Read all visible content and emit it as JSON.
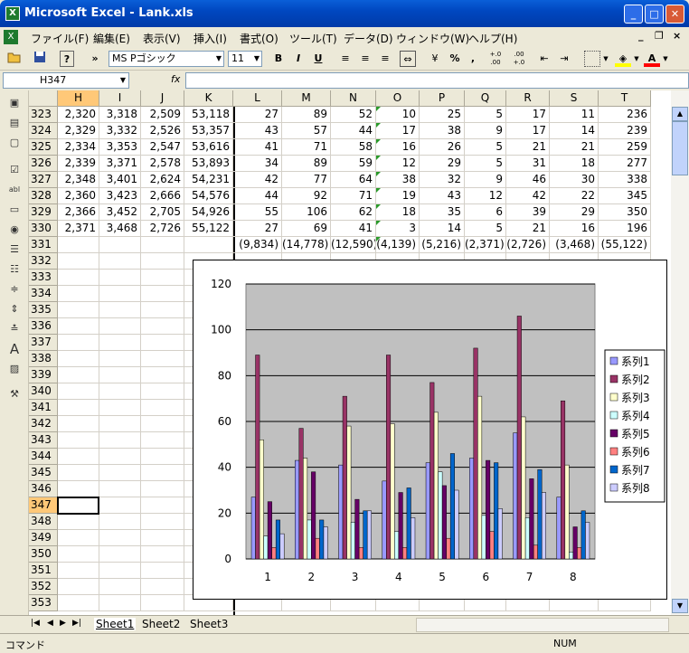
{
  "window": {
    "title": "Microsoft Excel - Lank.xls",
    "app_icon": "X",
    "min": "_",
    "max": "□",
    "close": "✕"
  },
  "menu": {
    "items": [
      "ファイル(F)",
      "編集(E)",
      "表示(V)",
      "挿入(I)",
      "書式(O)",
      "ツール(T)",
      "データ(D)",
      "ウィンドウ(W)",
      "ヘルプ(H)"
    ],
    "doc_min": "_",
    "doc_restore": "❐",
    "doc_close": "×"
  },
  "toolbar": {
    "font": "MS Pゴシック",
    "size": "11",
    "bold": "B",
    "italic": "I",
    "underline": "U",
    "percent": "%",
    "comma": ",",
    "inc_dec": "+.0 .00",
    "dec_dec": ".00 +.0",
    "more": "»"
  },
  "formula": {
    "name_box": "H347",
    "fx": "fx",
    "value": ""
  },
  "columns": [
    "H",
    "I",
    "J",
    "K",
    "L",
    "M",
    "N",
    "O",
    "P",
    "Q",
    "R",
    "S",
    "T"
  ],
  "selected_column": "H",
  "rows": [
    {
      "n": "323",
      "v": [
        "2,320",
        "3,318",
        "2,509",
        "53,118",
        "27",
        "89",
        "52",
        "10",
        "25",
        "5",
        "17",
        "11",
        "236"
      ]
    },
    {
      "n": "324",
      "v": [
        "2,329",
        "3,332",
        "2,526",
        "53,357",
        "43",
        "57",
        "44",
        "17",
        "38",
        "9",
        "17",
        "14",
        "239"
      ]
    },
    {
      "n": "325",
      "v": [
        "2,334",
        "3,353",
        "2,547",
        "53,616",
        "41",
        "71",
        "58",
        "16",
        "26",
        "5",
        "21",
        "21",
        "259"
      ]
    },
    {
      "n": "326",
      "v": [
        "2,339",
        "3,371",
        "2,578",
        "53,893",
        "34",
        "89",
        "59",
        "12",
        "29",
        "5",
        "31",
        "18",
        "277"
      ]
    },
    {
      "n": "327",
      "v": [
        "2,348",
        "3,401",
        "2,624",
        "54,231",
        "42",
        "77",
        "64",
        "38",
        "32",
        "9",
        "46",
        "30",
        "338"
      ]
    },
    {
      "n": "328",
      "v": [
        "2,360",
        "3,423",
        "2,666",
        "54,576",
        "44",
        "92",
        "71",
        "19",
        "43",
        "12",
        "42",
        "22",
        "345"
      ]
    },
    {
      "n": "329",
      "v": [
        "2,366",
        "3,452",
        "2,705",
        "54,926",
        "55",
        "106",
        "62",
        "18",
        "35",
        "6",
        "39",
        "29",
        "350"
      ]
    },
    {
      "n": "330",
      "v": [
        "2,371",
        "3,468",
        "2,726",
        "55,122",
        "27",
        "69",
        "41",
        "3",
        "14",
        "5",
        "21",
        "16",
        "196"
      ]
    },
    {
      "n": "331",
      "v": [
        "",
        "",
        "",
        "",
        "(9,834)",
        "(14,778)",
        "(12,590)",
        "(4,139)",
        "(5,216)",
        "(2,371)",
        "(2,726)",
        "(3,468)",
        "(55,122)"
      ]
    },
    {
      "n": "332",
      "v": []
    },
    {
      "n": "333",
      "v": []
    },
    {
      "n": "334",
      "v": []
    },
    {
      "n": "335",
      "v": []
    },
    {
      "n": "336",
      "v": []
    },
    {
      "n": "337",
      "v": []
    },
    {
      "n": "338",
      "v": []
    },
    {
      "n": "339",
      "v": []
    },
    {
      "n": "340",
      "v": []
    },
    {
      "n": "341",
      "v": []
    },
    {
      "n": "342",
      "v": []
    },
    {
      "n": "343",
      "v": []
    },
    {
      "n": "344",
      "v": []
    },
    {
      "n": "345",
      "v": []
    },
    {
      "n": "346",
      "v": []
    },
    {
      "n": "347",
      "v": []
    },
    {
      "n": "348",
      "v": []
    },
    {
      "n": "349",
      "v": []
    },
    {
      "n": "350",
      "v": []
    },
    {
      "n": "351",
      "v": []
    },
    {
      "n": "352",
      "v": []
    },
    {
      "n": "353",
      "v": []
    }
  ],
  "selected_row": "347",
  "sheets": [
    "Sheet1",
    "Sheet2",
    "Sheet3"
  ],
  "active_sheet": "Sheet1",
  "status": {
    "mode": "コマンド",
    "num": "NUM"
  },
  "chart_data": {
    "type": "bar",
    "categories": [
      "1",
      "2",
      "3",
      "4",
      "5",
      "6",
      "7",
      "8"
    ],
    "ylim": [
      0,
      120
    ],
    "yticks": [
      "0",
      "20",
      "40",
      "60",
      "80",
      "100",
      "120"
    ],
    "grid": true,
    "legend_position": "right",
    "series": [
      {
        "name": "系列1",
        "color": "#9999ff",
        "values": [
          27,
          43,
          41,
          34,
          42,
          44,
          55,
          27
        ]
      },
      {
        "name": "系列2",
        "color": "#993366",
        "values": [
          89,
          57,
          71,
          89,
          77,
          92,
          106,
          69
        ]
      },
      {
        "name": "系列3",
        "color": "#ffffcc",
        "values": [
          52,
          44,
          58,
          59,
          64,
          71,
          62,
          41
        ]
      },
      {
        "name": "系列4",
        "color": "#ccffff",
        "values": [
          10,
          17,
          16,
          12,
          38,
          19,
          18,
          3
        ]
      },
      {
        "name": "系列5",
        "color": "#660066",
        "values": [
          25,
          38,
          26,
          29,
          32,
          43,
          35,
          14
        ]
      },
      {
        "name": "系列6",
        "color": "#ff8080",
        "values": [
          5,
          9,
          5,
          5,
          9,
          12,
          6,
          5
        ]
      },
      {
        "name": "系列7",
        "color": "#0066cc",
        "values": [
          17,
          17,
          21,
          31,
          46,
          42,
          39,
          21
        ]
      },
      {
        "name": "系列8",
        "color": "#ccccff",
        "values": [
          11,
          14,
          21,
          18,
          30,
          22,
          29,
          16
        ]
      }
    ]
  }
}
